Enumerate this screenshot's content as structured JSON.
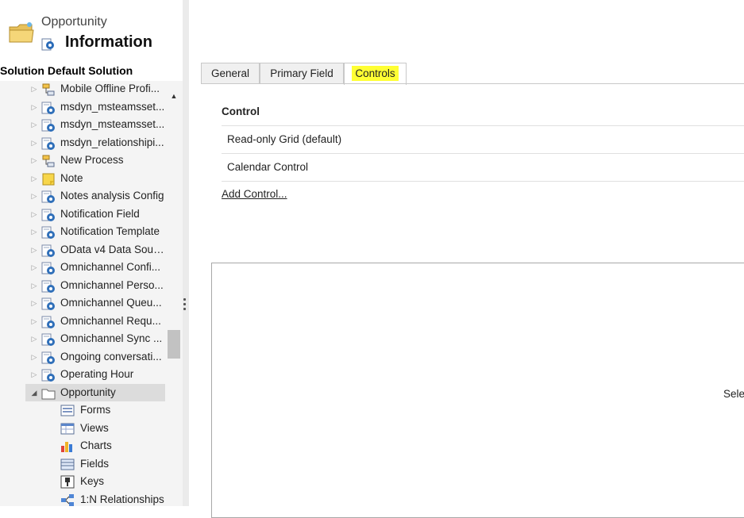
{
  "header": {
    "entity_name": "Opportunity",
    "page_title": "Information"
  },
  "solution_title": "Solution Default Solution",
  "tree": {
    "items": [
      {
        "label": "Mobile Offline Profi...",
        "icon": "process-icon"
      },
      {
        "label": "msdyn_msteamsset...",
        "icon": "entity-gear-icon"
      },
      {
        "label": "msdyn_msteamsset...",
        "icon": "entity-gear-icon"
      },
      {
        "label": "msdyn_relationshipi...",
        "icon": "entity-gear-icon"
      },
      {
        "label": "New Process",
        "icon": "process-icon"
      },
      {
        "label": "Note",
        "icon": "note-icon"
      },
      {
        "label": "Notes analysis Config",
        "icon": "entity-gear-icon"
      },
      {
        "label": "Notification Field",
        "icon": "entity-gear-icon"
      },
      {
        "label": "Notification Template",
        "icon": "entity-gear-icon"
      },
      {
        "label": "OData v4 Data Sour...",
        "icon": "entity-gear-icon"
      },
      {
        "label": "Omnichannel Confi...",
        "icon": "entity-gear-icon"
      },
      {
        "label": "Omnichannel Perso...",
        "icon": "entity-gear-icon"
      },
      {
        "label": "Omnichannel Queu...",
        "icon": "entity-gear-icon"
      },
      {
        "label": "Omnichannel Requ...",
        "icon": "entity-gear-icon"
      },
      {
        "label": "Omnichannel Sync ...",
        "icon": "entity-gear-icon"
      },
      {
        "label": "Ongoing conversati...",
        "icon": "entity-gear-icon"
      },
      {
        "label": "Operating Hour",
        "icon": "entity-gear-icon"
      },
      {
        "label": "Opportunity",
        "icon": "folder-icon",
        "expanded": true,
        "selected": true
      }
    ],
    "subitems": [
      {
        "label": "Forms",
        "icon": "forms-icon"
      },
      {
        "label": "Views",
        "icon": "views-icon"
      },
      {
        "label": "Charts",
        "icon": "charts-icon"
      },
      {
        "label": "Fields",
        "icon": "fields-icon"
      },
      {
        "label": "Keys",
        "icon": "keys-icon"
      },
      {
        "label": "1:N Relationships",
        "icon": "relationships-icon"
      }
    ]
  },
  "tabs": [
    {
      "label": "General"
    },
    {
      "label": "Primary Field"
    },
    {
      "label": "Controls",
      "active": true
    }
  ],
  "controls": {
    "header": "Control",
    "rows": [
      {
        "label": "Read-only Grid (default)"
      },
      {
        "label": "Calendar Control"
      }
    ],
    "add_link": "Add Control..."
  },
  "preview_text": "Selec",
  "colors": {
    "highlight": "#ffff33",
    "tree_bg": "#f4f4f4",
    "selected_row": "#dcdcdc",
    "border": "#c8c8c8"
  }
}
